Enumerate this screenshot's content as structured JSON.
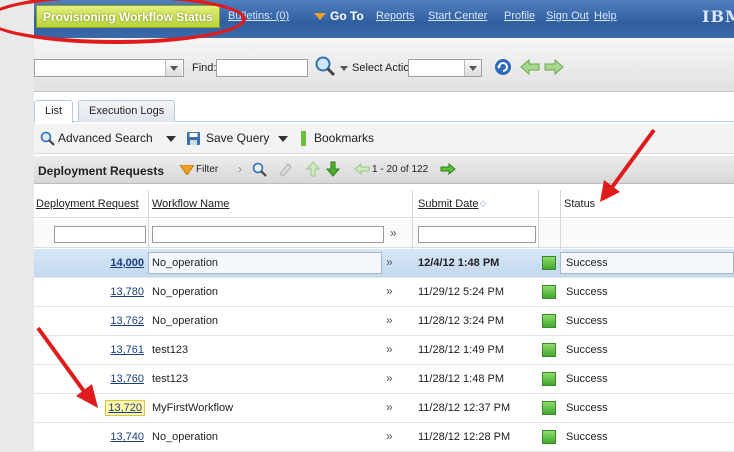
{
  "header": {
    "app_title": "Provisioning Workflow Status",
    "links": {
      "bulletins": "Bulletins: (0)",
      "goto": "Go To",
      "reports": "Reports",
      "start_center": "Start Center",
      "profile": "Profile",
      "sign_out": "Sign Out",
      "help": "Help"
    },
    "logo_text": "IBM"
  },
  "toolbar": {
    "find_label": "Find:",
    "find_value": "",
    "action_placeholder": "Select Action"
  },
  "tabs": [
    {
      "label": "List",
      "active": true
    },
    {
      "label": "Execution Logs",
      "active": false
    }
  ],
  "search_bar": {
    "advanced_search": "Advanced Search",
    "save_query": "Save Query",
    "bookmarks": "Bookmarks"
  },
  "table": {
    "title": "Deployment Requests",
    "filter_label": "Filter",
    "paging_text": "1 - 20 of 122",
    "columns": {
      "request": "Deployment Request",
      "workflow": "Workflow Name",
      "submit_date": "Submit Date",
      "status": "Status"
    },
    "rows": [
      {
        "id": "14,000",
        "workflow": "No_operation",
        "date": "12/4/12 1:48 PM",
        "status": "Success"
      },
      {
        "id": "13,780",
        "workflow": "No_operation",
        "date": "11/29/12 5:24 PM",
        "status": "Success"
      },
      {
        "id": "13,762",
        "workflow": "No_operation",
        "date": "11/28/12 3:24 PM",
        "status": "Success"
      },
      {
        "id": "13,761",
        "workflow": "test123",
        "date": "11/28/12 1:49 PM",
        "status": "Success"
      },
      {
        "id": "13,760",
        "workflow": "test123",
        "date": "11/28/12 1:48 PM",
        "status": "Success"
      },
      {
        "id": "13,720",
        "workflow": "MyFirstWorkflow",
        "date": "11/28/12 12:37 PM",
        "status": "Success"
      },
      {
        "id": "13,740",
        "workflow": "No_operation",
        "date": "11/28/12 12:28 PM",
        "status": "Success"
      }
    ]
  },
  "colors": {
    "annotation": "#e01b1b",
    "header_bg": "#2f5f9e",
    "title_bg": "#b9d33a",
    "status_success": "#43a830",
    "selected_row": "#c4d9ef"
  }
}
